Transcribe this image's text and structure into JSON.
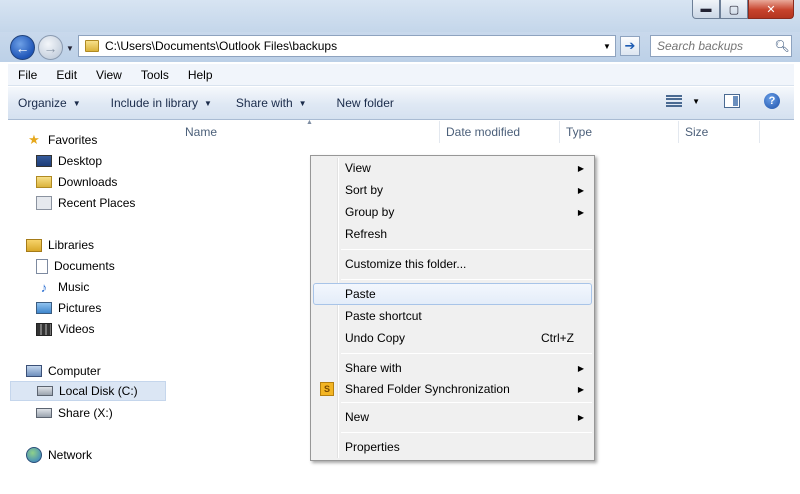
{
  "window": {
    "minimize": "▬",
    "maximize": "▢",
    "close": "✕"
  },
  "nav": {
    "back_glyph": "←",
    "forward_glyph": "→",
    "address": "C:\\Users\\Documents\\Outlook Files\\backups",
    "go_glyph": "➔",
    "search_placeholder": "Search backups"
  },
  "menubar": [
    "File",
    "Edit",
    "View",
    "Tools",
    "Help"
  ],
  "commandbar": {
    "organize": "Organize",
    "include_in_library": "Include in library",
    "share_with": "Share with",
    "new_folder": "New folder"
  },
  "sidebar": {
    "favorites": "Favorites",
    "desktop": "Desktop",
    "downloads": "Downloads",
    "recent_places": "Recent Places",
    "libraries": "Libraries",
    "documents": "Documents",
    "music": "Music",
    "pictures": "Pictures",
    "videos": "Videos",
    "computer": "Computer",
    "local_disk": "Local Disk (C:)",
    "share": "Share (X:)",
    "network": "Network"
  },
  "columns": {
    "name": "Name",
    "date_modified": "Date modified",
    "type": "Type",
    "size": "Size"
  },
  "context_menu": {
    "view": "View",
    "sort_by": "Sort by",
    "group_by": "Group by",
    "refresh": "Refresh",
    "customize": "Customize this folder...",
    "paste": "Paste",
    "paste_shortcut": "Paste shortcut",
    "undo_copy": "Undo Copy",
    "undo_copy_shortcut": "Ctrl+Z",
    "share_with": "Share with",
    "shared_folder_sync": "Shared Folder Synchronization",
    "new": "New",
    "properties": "Properties"
  },
  "colors": {
    "titlebar": "#c4d6ea",
    "hover_border": "#a8c4e8",
    "selection": "#dbe6f4"
  }
}
